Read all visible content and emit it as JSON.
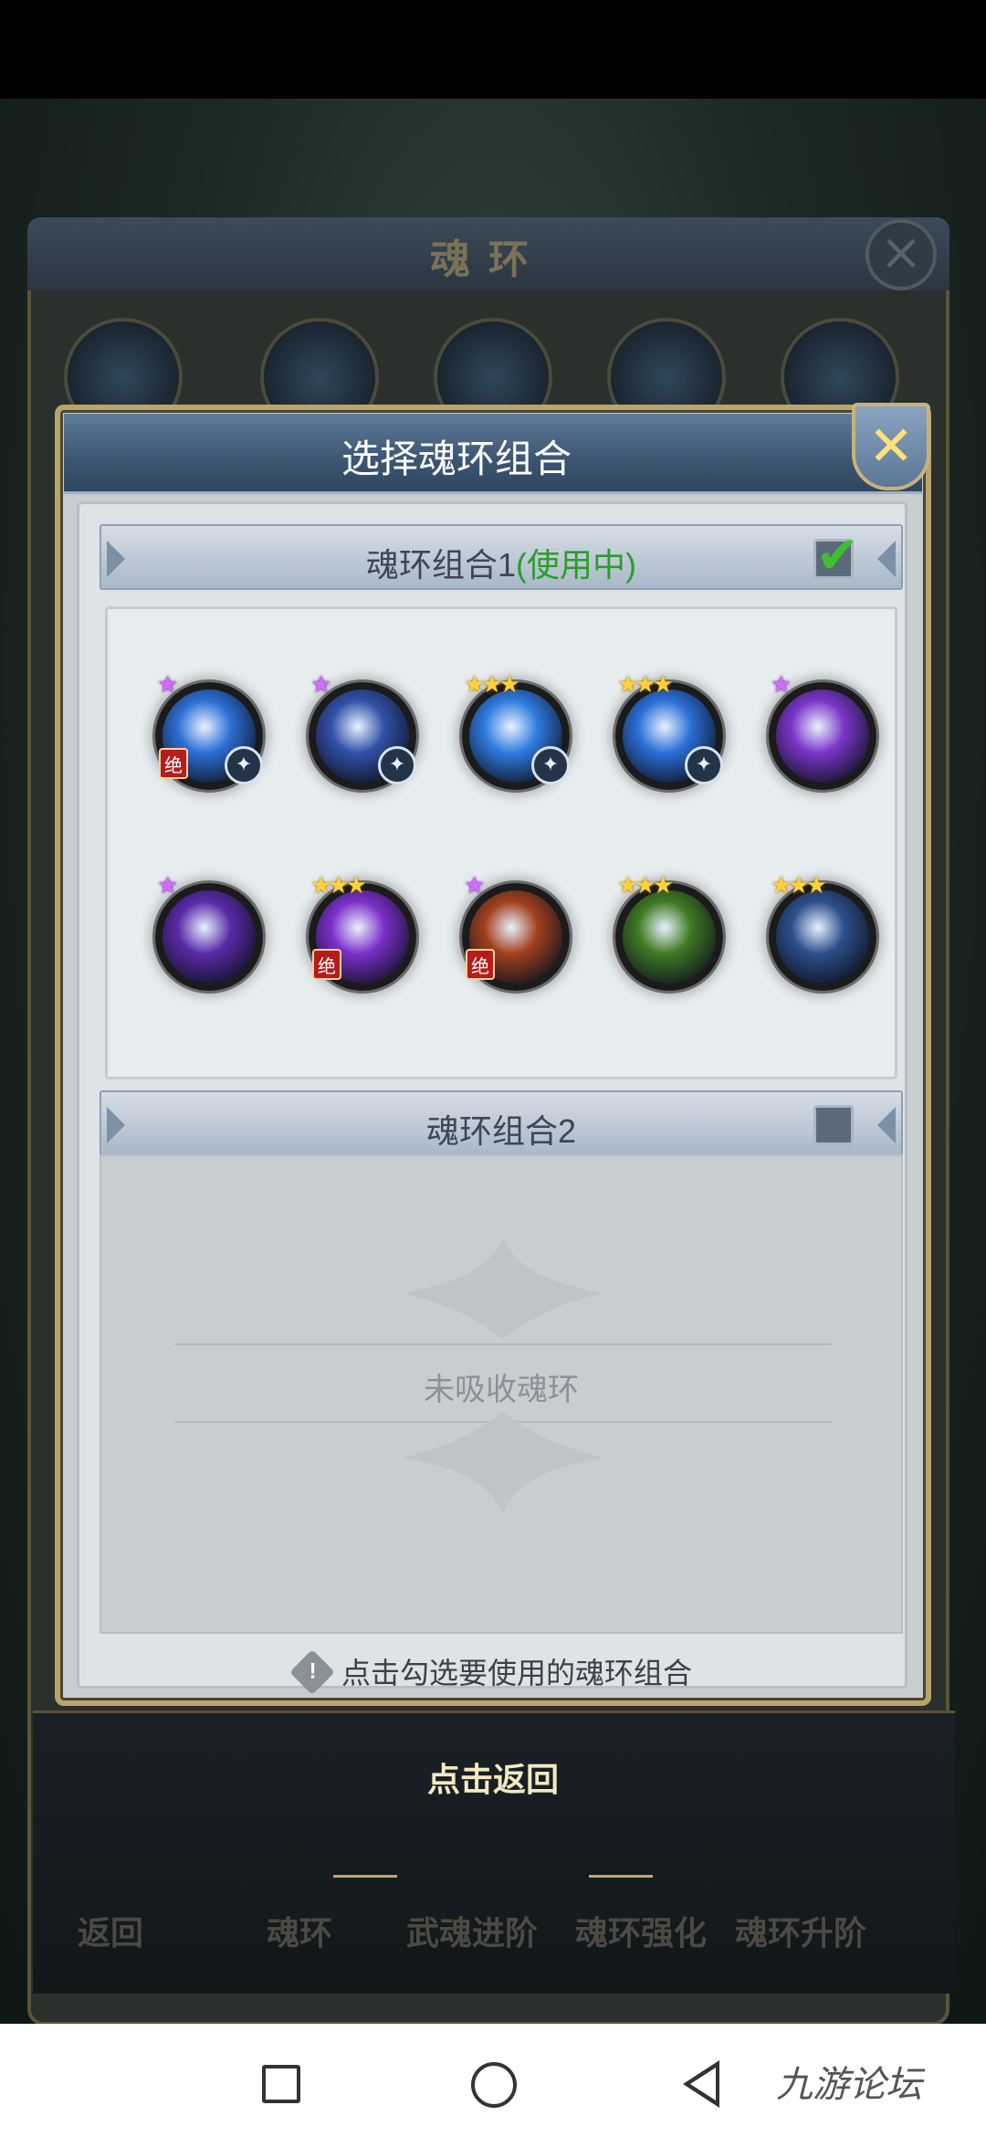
{
  "background": {
    "title": "魂环",
    "bottom_tabs": [
      "返回",
      "魂环",
      "武魂进阶",
      "魂环强化",
      "魂环升阶"
    ]
  },
  "dialog": {
    "title": "选择魂环组合",
    "close_icon": "close-icon",
    "groups": [
      {
        "label": "魂环组合1",
        "status": "(使用中)",
        "checked": true,
        "rings": [
          {
            "stars": 1,
            "star_color": "purple",
            "tag": "绝",
            "badge": "skill-icon",
            "color": "#2d6fd6"
          },
          {
            "stars": 1,
            "star_color": "purple",
            "tag": "",
            "badge": "skill-icon",
            "color": "#3151a8"
          },
          {
            "stars": 3,
            "star_color": "gold",
            "tag": "",
            "badge": "skill-icon",
            "color": "#2f7be0"
          },
          {
            "stars": 3,
            "star_color": "gold",
            "tag": "",
            "badge": "skill-icon",
            "color": "#2b6fd8"
          },
          {
            "stars": 1,
            "star_color": "purple",
            "tag": "",
            "badge": "",
            "color": "#7a35c8"
          },
          {
            "stars": 1,
            "star_color": "purple",
            "tag": "",
            "badge": "",
            "color": "#5a2aa8"
          },
          {
            "stars": 3,
            "star_color": "gold",
            "tag": "绝",
            "badge": "",
            "color": "#7c2fc9"
          },
          {
            "stars": 1,
            "star_color": "purple",
            "tag": "绝",
            "badge": "",
            "color": "#a1401c"
          },
          {
            "stars": 3,
            "star_color": "gold",
            "tag": "",
            "badge": "",
            "color": "#3f7a22"
          },
          {
            "stars": 3,
            "star_color": "gold",
            "tag": "",
            "badge": "",
            "color": "#2c4f8a"
          }
        ]
      },
      {
        "label": "魂环组合2",
        "status": "",
        "checked": false,
        "empty_text": "未吸收魂环"
      }
    ],
    "hint": "点击勾选要使用的魂环组合"
  },
  "back_label": "点击返回",
  "watermark": "九游论坛"
}
